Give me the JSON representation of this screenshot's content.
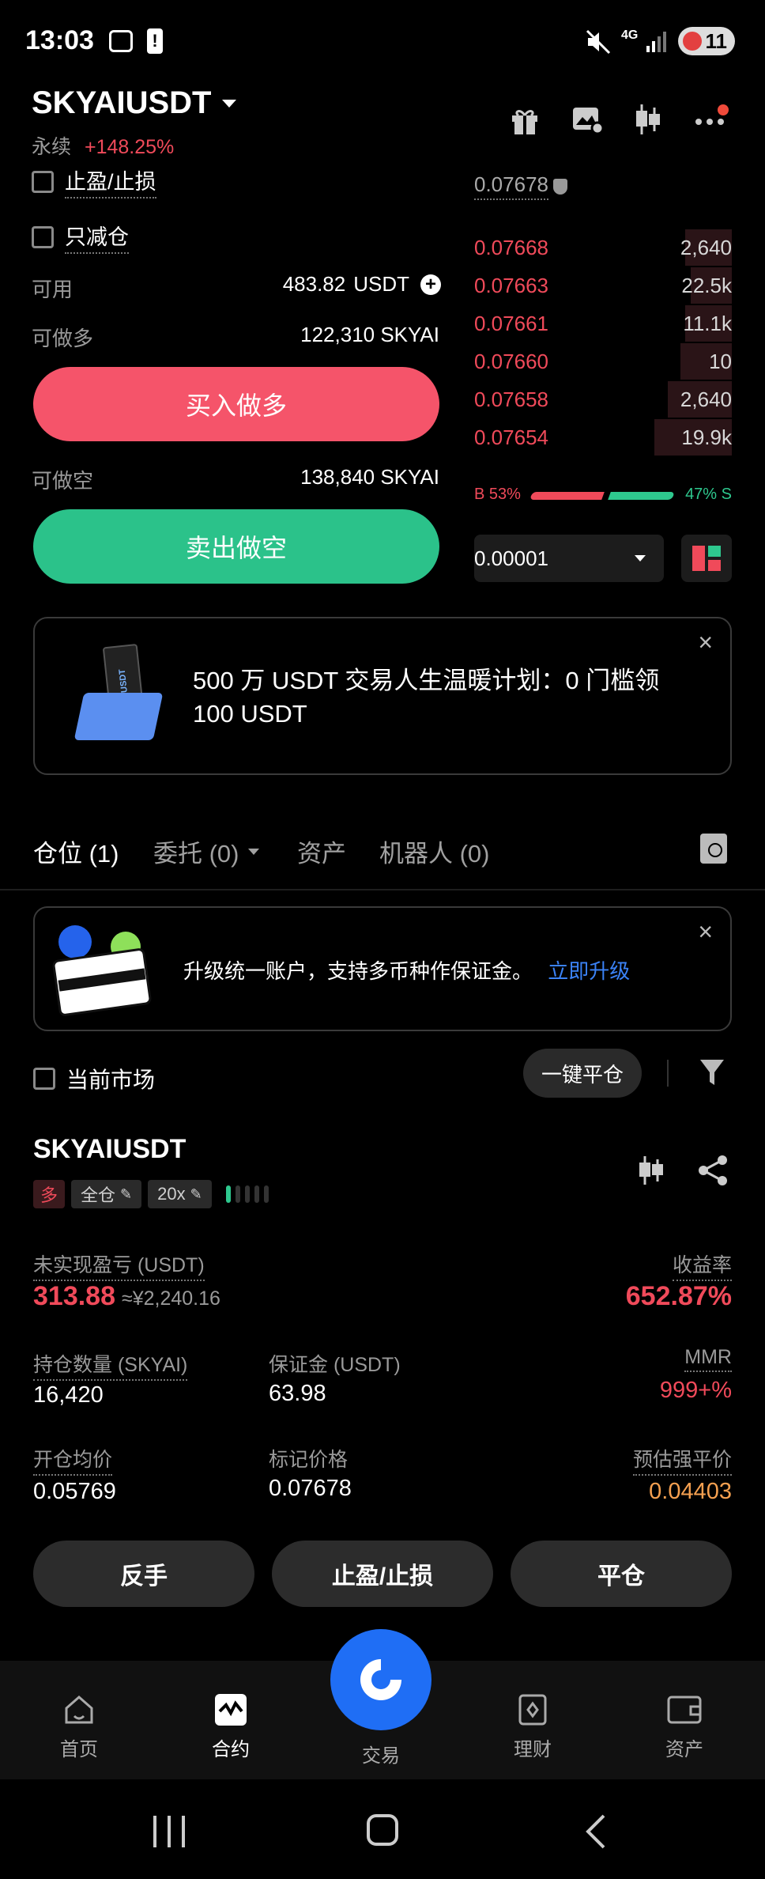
{
  "status_bar": {
    "time": "13:03",
    "network": "4G",
    "battery": "11"
  },
  "header": {
    "pair": "SKYAIUSDT",
    "contract_type": "永续",
    "change": "+148.25%"
  },
  "form": {
    "tp_sl_label": "止盈/止损",
    "reduce_only_label": "只减仓",
    "available_label": "可用",
    "available_value": "483.82",
    "available_unit": "USDT",
    "can_long_label": "可做多",
    "can_long_value": "122,310 SKYAI",
    "buy_button": "买入做多",
    "can_short_label": "可做空",
    "can_short_value": "138,840 SKYAI",
    "sell_button": "卖出做空"
  },
  "orderbook": {
    "last_price": "0.07678",
    "asks": [
      {
        "price": "0.07668",
        "qty": "2,640",
        "depth": 0.18
      },
      {
        "price": "0.07663",
        "qty": "22.5k",
        "depth": 0.16
      },
      {
        "price": "0.07661",
        "qty": "11.1k",
        "depth": 0.18
      },
      {
        "price": "0.07660",
        "qty": "10",
        "depth": 0.2
      },
      {
        "price": "0.07658",
        "qty": "2,640",
        "depth": 0.25
      },
      {
        "price": "0.07654",
        "qty": "19.9k",
        "depth": 0.3
      }
    ],
    "buy_ratio": "B 53%",
    "sell_ratio": "47% S",
    "buy_pct": 53,
    "precision": "0.00001"
  },
  "promo": {
    "text": "500 万 USDT 交易人生温暖计划：0 门槛领 100 USDT",
    "card_label": "USDT"
  },
  "tabs": {
    "positions": "仓位 (1)",
    "orders": "委托 (0)",
    "assets": "资产",
    "bots": "机器人 (0)"
  },
  "upgrade_banner": {
    "text": "升级统一账户，支持多币种作保证金。",
    "link": "立即升级"
  },
  "filter": {
    "current_market": "当前市场",
    "close_all": "一键平仓"
  },
  "position": {
    "symbol": "SKYAIUSDT",
    "side": "多",
    "margin_mode": "全仓",
    "leverage": "20x",
    "upnl_label": "未实现盈亏 (USDT)",
    "upnl_value": "313.88",
    "upnl_cny": "≈¥2,240.16",
    "roe_label": "收益率",
    "roe_value": "652.87%",
    "size_label": "持仓数量 (SKYAI)",
    "size_value": "16,420",
    "margin_label": "保证金 (USDT)",
    "margin_value": "63.98",
    "mmr_label": "MMR",
    "mmr_value": "999+%",
    "entry_label": "开仓均价",
    "entry_value": "0.05769",
    "mark_label": "标记价格",
    "mark_value": "0.07678",
    "liq_label": "预估强平价",
    "liq_value": "0.04403",
    "reverse_button": "反手",
    "tpsl_button": "止盈/止损",
    "close_button": "平仓"
  },
  "bottom_nav": [
    {
      "label": "首页",
      "icon": "home-icon"
    },
    {
      "label": "合约",
      "icon": "futures-icon"
    },
    {
      "label": "交易",
      "icon": "trade-icon"
    },
    {
      "label": "理财",
      "icon": "earn-icon"
    },
    {
      "label": "资产",
      "icon": "wallet-icon"
    }
  ],
  "colors": {
    "red": "#f04a5a",
    "green": "#2ec88e",
    "blue": "#1f6ef5",
    "orange": "#f5a050"
  }
}
